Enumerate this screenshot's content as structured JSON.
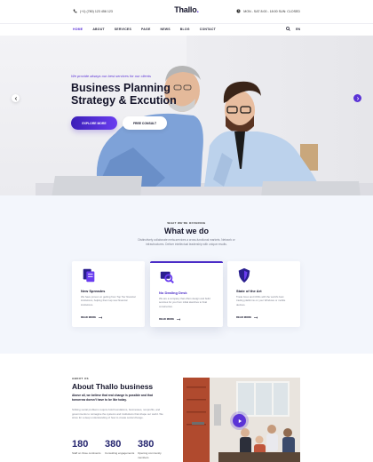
{
  "header": {
    "phone": "(+1) (780) 123 456 123",
    "logo": "Thallo",
    "logo_dot": ".",
    "hours": "MON - SAT 8:00 - 18:00 SUN: CLOSED"
  },
  "nav": {
    "items": [
      "HOME",
      "ABOUT",
      "SERVICES",
      "PAGE",
      "NEWS",
      "BLOG",
      "CONTACT"
    ],
    "active_index": 0,
    "lang": "EN"
  },
  "hero": {
    "tagline": "We provide always our best services for our clients",
    "title": "Business Planning Strategy & Excution",
    "primary_button": "EXPLORE MORE",
    "secondary_button": "FREE CONSULT",
    "prev_icon": "chevron-left-icon",
    "next_icon": "chevron-right-icon"
  },
  "what_we_do": {
    "eyebrow": "WHAT WE'RE OFFERING",
    "title": "What we do",
    "subtitle": "Distinctively collaborate meta-services a cross-functional markets. Network or infrastructures. Deliver intellectual leadership with unique results.",
    "cards": [
      {
        "icon": "documents-icon",
        "title": "New Spreades",
        "text": "We have proven on getting from Top Tier financial institutions, helping them tap new financial institutions.",
        "more": "READ MORE"
      },
      {
        "icon": "magnifier-icon",
        "title": "No Dealing Desk",
        "text": "We are a company that offers design and build services for you from initial sketches to final construction.",
        "more": "READ MORE"
      },
      {
        "icon": "shield-icon",
        "title": "State of the Art",
        "text": "Trade forex and CFDs with the world's best trading platforms on your Windows or mobile devices.",
        "more": "READ MORE"
      }
    ]
  },
  "about": {
    "eyebrow": "ABOUT US",
    "title": "About Thallo business",
    "lead": "Above all, we believe that real change is possible and that tomorrow doesn't have to be like today.",
    "body": "Striking social problems require bold foundations, businesses, nonprofits, and governments to reimagine the systems and institutions that shape our world. We strive for a deep understanding of how to create social change.",
    "stats": [
      {
        "value": "180",
        "label": "Staff on three continents"
      },
      {
        "value": "380",
        "label": "Consulting engagements"
      },
      {
        "value": "380",
        "label": "Opening community members"
      }
    ],
    "play_icon": "play-icon"
  },
  "colors": {
    "accent": "#5b33d6",
    "dark": "#14142a",
    "section_bg": "#f3f6fc"
  }
}
